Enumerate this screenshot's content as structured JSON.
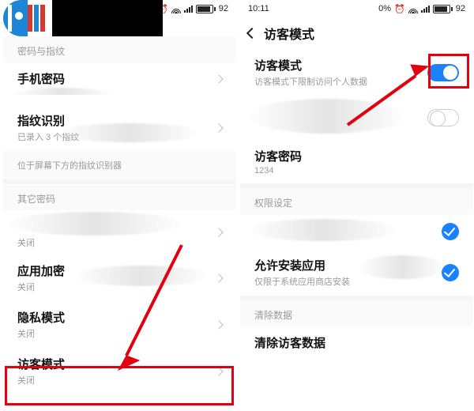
{
  "left": {
    "status": {
      "battery": "92"
    },
    "sections": {
      "pwd_fp_header": "密码与指纹",
      "phone_pwd": {
        "title": "手机密码",
        "sub": ""
      },
      "fingerprint": {
        "title": "指纹识别",
        "sub": "已录入 3 个指纹"
      },
      "fp_hint": "位于屏幕下方的指纹识别器",
      "other_pwd_header": "其它密码",
      "other_closed": "关闭",
      "app_lock": {
        "title": "应用加密",
        "sub": "关闭"
      },
      "private_mode": {
        "title": "隐私模式",
        "sub": "关闭"
      },
      "guest_mode": {
        "title": "访客模式",
        "sub": "关闭"
      }
    }
  },
  "right": {
    "status": {
      "time": "10:11",
      "pct": "0%",
      "battery": "92"
    },
    "title": "访客模式",
    "guest_toggle": {
      "title": "访客模式",
      "sub": "访客模式下限制访问个人数据"
    },
    "guest_pwd": {
      "title": "访客密码",
      "value": "1234"
    },
    "perm_header": "权限设定",
    "allow_install": {
      "title": "允许安装应用",
      "sub": "仅限于系统应用商店安装"
    },
    "clear_header": "清除数据",
    "clear_item": "清除访客数据"
  }
}
